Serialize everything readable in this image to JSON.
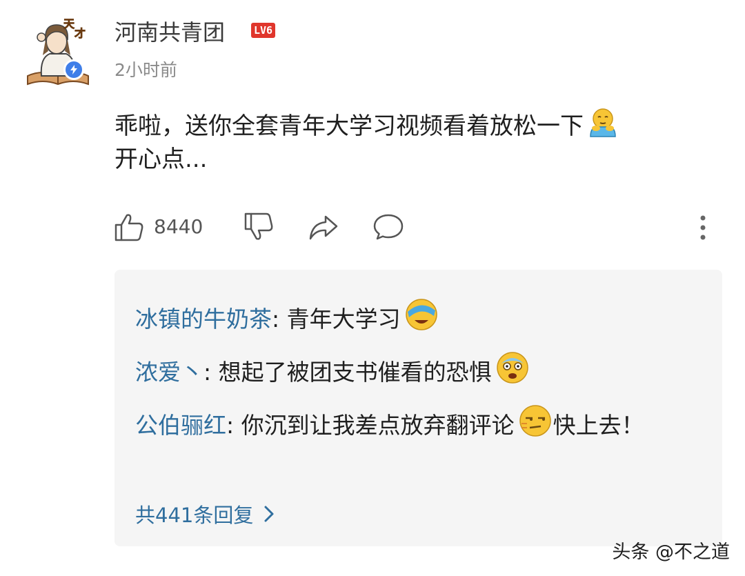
{
  "author": {
    "name": "河南共青团",
    "level": "LV6",
    "avatar_text": "天才",
    "time": "2小时前"
  },
  "comment": {
    "text": "乖啦，送你全套青年大学习视频看着放松一下",
    "text2": "开心点..."
  },
  "actions": {
    "like_count": "8440"
  },
  "replies": [
    {
      "author": "冰镇的牛奶茶",
      "sep": ": ",
      "text": "青年大学习"
    },
    {
      "author": "浓爱丶",
      "sep": ": ",
      "text": "想起了被团支书催看的恐惧"
    },
    {
      "author": "公伯骊红",
      "sep": ": ",
      "text": "你沉到让我差点放弃翻评论",
      "text_after": "快上去！"
    }
  ],
  "replies_more": "共441条回复",
  "watermark": "头条 @不之道",
  "colors": {
    "link_blue": "#2f6e9e",
    "level_red": "#e0362c",
    "reply_bg": "#f5f5f5"
  },
  "icons": [
    "like-icon",
    "dislike-icon",
    "share-icon",
    "comment-icon",
    "more-vertical-icon",
    "verified-icon",
    "chevron-right-icon"
  ]
}
